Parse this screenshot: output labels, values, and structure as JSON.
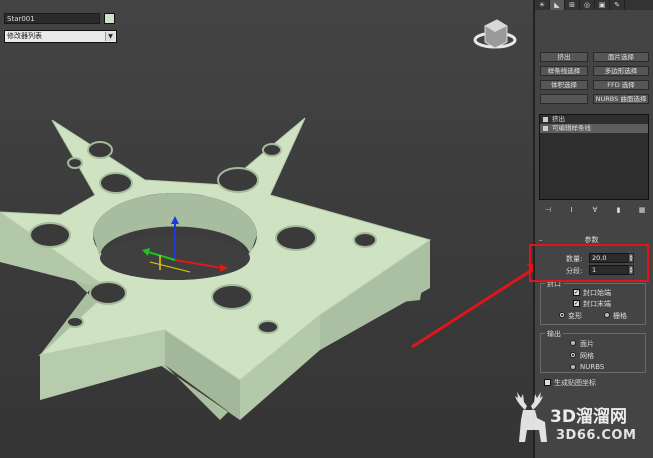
{
  "panel": {
    "tabs": [
      "sun-icon",
      "curve-icon",
      "hierarchy-icon",
      "motion-icon",
      "display-icon",
      "wrench-icon"
    ],
    "object_name": "Star001",
    "modifier_list": "修改器列表",
    "modifier_buttons": [
      [
        "挤出",
        "面片选择"
      ],
      [
        "样条线选择",
        "多边形选择"
      ],
      [
        "体积选择",
        "FFD 选择"
      ],
      [
        "",
        "NURBS 曲面选择"
      ]
    ],
    "stack_items": [
      "挤出",
      "可编辑样条线"
    ],
    "rollout_title": "参数",
    "amount_label": "数量:",
    "amount_value": "20.0",
    "segments_label": "分段:",
    "segments_value": "1",
    "cap_group_label": "封口",
    "cap_start_label": "封口始端",
    "cap_end_label": "封口末端",
    "morph_label": "变形",
    "grid_label": "栅格",
    "output_group_label": "输出",
    "output_patch_label": "面片",
    "output_mesh_label": "网格",
    "output_nurbs_label": "NURBS",
    "gen_mapping_label": "生成贴图坐标"
  },
  "watermark": {
    "brand": "3D溜溜网",
    "url": "3D66.COM"
  },
  "colors": {
    "highlight": "#e0141b",
    "object": "#cfe3c2"
  }
}
